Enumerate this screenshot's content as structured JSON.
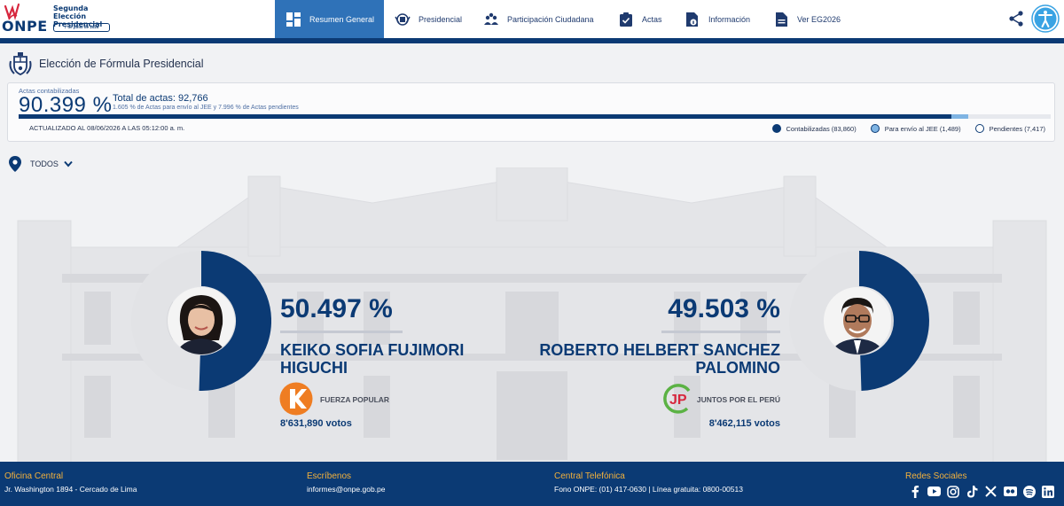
{
  "header": {
    "logo_text": "ONPE",
    "election_title": "Segunda Elección Presidencial",
    "election_date": "7 de junio de 2026",
    "nav": [
      {
        "label": "Resumen General",
        "icon": "dashboard-icon",
        "active": true
      },
      {
        "label": "Presidencial",
        "icon": "seal-icon",
        "active": false
      },
      {
        "label": "Participación Ciudadana",
        "icon": "people-icon",
        "active": false
      },
      {
        "label": "Actas",
        "icon": "clipboard-check-icon",
        "active": false
      },
      {
        "label": "Información",
        "icon": "document-info-icon",
        "active": false
      },
      {
        "label": "Ver EG2026",
        "icon": "document-icon",
        "active": false
      }
    ],
    "share_icon": "share-icon",
    "accessibility_icon": "accessibility-icon"
  },
  "section": {
    "title": "Elección de Fórmula Presidencial"
  },
  "progress": {
    "label": "Actas contabilizadas",
    "percent": "90.399 %",
    "total": "Total de actas: 92,766",
    "subtitle": "1.605 % de Actas para envío al JEE y 7.996 % de Actas pendientes",
    "updated": "ACTUALIZADO AL 08/06/2026 A LAS 05:12:00 a. m.",
    "fractions": {
      "contabilizadas": 0.90399,
      "jee": 0.01605,
      "pendientes": 0.07996
    },
    "legend": [
      {
        "label": "Contabilizadas (83,860)",
        "color": "#0b3a74"
      },
      {
        "label": "Para envío al JEE (1,489)",
        "color": "#7fb4e3"
      },
      {
        "label": "Pendientes (7,417)",
        "color": "#ffffff"
      }
    ]
  },
  "filter": {
    "label": "TODOS"
  },
  "candidates": [
    {
      "percent": "50.497 %",
      "share": 0.50497,
      "name_line1": "KEIKO SOFIA FUJIMORI",
      "name_line2": "HIGUCHI",
      "party": "FUERZA POPULAR",
      "votes": "8'631,890 votos",
      "party_color": "#ef7d22"
    },
    {
      "percent": "49.503 %",
      "share": 0.49503,
      "name_line1": "ROBERTO HELBERT SANCHEZ",
      "name_line2": "PALOMINO",
      "party": "JUNTOS POR EL PERÚ",
      "votes": "8'462,115 votos",
      "party_color": "#5bb244"
    }
  ],
  "colors": {
    "primary": "#0b3a74",
    "accent_active": "#2f72b8",
    "footer_heading": "#f3b13c",
    "donut_track": "#e2e3e6"
  },
  "footer": {
    "office_heading": "Oficina Central",
    "office_text": "Jr. Washington 1894 - Cercado de Lima",
    "write_heading": "Escríbenos",
    "write_text": "informes@onpe.gob.pe",
    "phone_heading": "Central Telefónica",
    "phone_text": "Fono ONPE: (01) 417-0630 | Línea gratuita: 0800-00513",
    "social_heading": "Redes Sociales",
    "social": [
      "facebook-icon",
      "youtube-icon",
      "instagram-icon",
      "tiktok-icon",
      "x-icon",
      "flickr-icon",
      "spotify-icon",
      "linkedin-icon"
    ]
  }
}
